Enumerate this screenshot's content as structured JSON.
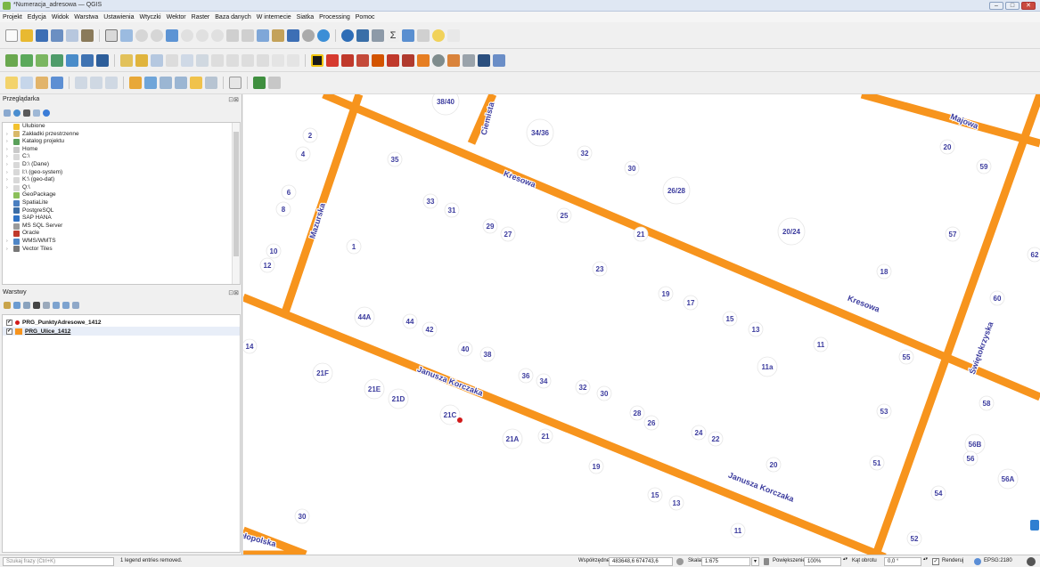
{
  "window": {
    "title": "*Numeracja_adresowa — QGIS",
    "min": "–",
    "max": "□",
    "close": "✕"
  },
  "menu": [
    "Projekt",
    "Edycja",
    "Widok",
    "Warstwa",
    "Ustawienia",
    "Wtyczki",
    "Wektor",
    "Raster",
    "Baza danych",
    "W internecie",
    "Siatka",
    "Processing",
    "Pomoc"
  ],
  "browser_panel": {
    "title": "Przeglądarka",
    "controls": "⊡⊠",
    "items": [
      {
        "label": "Ulubione",
        "color": "#f2c12e"
      },
      {
        "label": "Zakładki przestrzenne",
        "color": "#d9b96a"
      },
      {
        "label": "Katalog projektu",
        "color": "#5aa05a"
      },
      {
        "label": "Home",
        "color": "#c9c9c9"
      },
      {
        "label": "C:\\",
        "color": "#d8d8d8"
      },
      {
        "label": "D:\\ (Dane)",
        "color": "#d8d8d8"
      },
      {
        "label": "I:\\ (geo-system)",
        "color": "#d8d8d8"
      },
      {
        "label": "K:\\ (geo-dat)",
        "color": "#d8d8d8"
      },
      {
        "label": "Q:\\",
        "color": "#d8d8d8"
      },
      {
        "label": "GeoPackage",
        "color": "#8bbf5a"
      },
      {
        "label": "SpatiaLite",
        "color": "#4a7fc0"
      },
      {
        "label": "PostgreSQL",
        "color": "#3b6da6"
      },
      {
        "label": "SAP HANA",
        "color": "#2f72c4"
      },
      {
        "label": "MS SQL Server",
        "color": "#9a9a9a"
      },
      {
        "label": "Oracle",
        "color": "#c0392b"
      },
      {
        "label": "WMS/WMTS",
        "color": "#4f86c6"
      },
      {
        "label": "Vector Tiles",
        "color": "#777777"
      }
    ]
  },
  "layers_panel": {
    "title": "Warstwy",
    "controls": "⊡⊠",
    "items": [
      {
        "label": "PRG_PunktyAdresowe_1412",
        "checked": "✓",
        "symbol_color": "#d11a1a"
      },
      {
        "label": "PRG_Ulice_1412",
        "checked": "✓",
        "symbol_color": "#f7941d"
      }
    ]
  },
  "map": {
    "road_color": "#f7941d",
    "label_color": "#3c3c9e",
    "streets": [
      {
        "name": "Majowa"
      },
      {
        "name": "Kresowa"
      },
      {
        "name": "Kresowa"
      },
      {
        "name": "Ciemista"
      },
      {
        "name": "Mazurska"
      },
      {
        "name": "Świętokrzyska"
      },
      {
        "name": "Janusza Korczaka"
      },
      {
        "name": "Janusza Korczaka"
      },
      {
        "name": "Małopolska"
      }
    ],
    "address_points": [
      "38/40",
      "34/36",
      "32",
      "30",
      "26/28",
      "20",
      "59",
      "2",
      "4",
      "35",
      "6",
      "8",
      "33",
      "31",
      "25",
      "29",
      "27",
      "21",
      "20/24",
      "57",
      "62",
      "10",
      "12",
      "1",
      "23",
      "18",
      "19",
      "17",
      "60",
      "44A",
      "44",
      "42",
      "15",
      "13",
      "11",
      "55",
      "14",
      "40",
      "38",
      "11a",
      "21F",
      "36",
      "34",
      "32",
      "30",
      "21E",
      "21D",
      "53",
      "58",
      "21C",
      "28",
      "26",
      "24",
      "22",
      "21A",
      "21",
      "56B",
      "56",
      "19",
      "20",
      "51",
      "56A",
      "15",
      "13",
      "54",
      "30",
      "11",
      "52"
    ]
  },
  "status": {
    "search_placeholder": "Szukaj frazy (Ctrl+K)",
    "message": "1 legend entries removed.",
    "coord_label": "Współrzędne",
    "coord_value": "483648,6 674743,6",
    "scale_label": "Skala",
    "scale_value": "1:675",
    "magnifier_label": "Powiększenie",
    "magnifier_value": "100%",
    "rotation_label": "Kąt obrotu",
    "rotation_value": "0,0 °",
    "render_label": "Renderuj",
    "render_check": "✓",
    "crs": "EPSG:2180"
  }
}
